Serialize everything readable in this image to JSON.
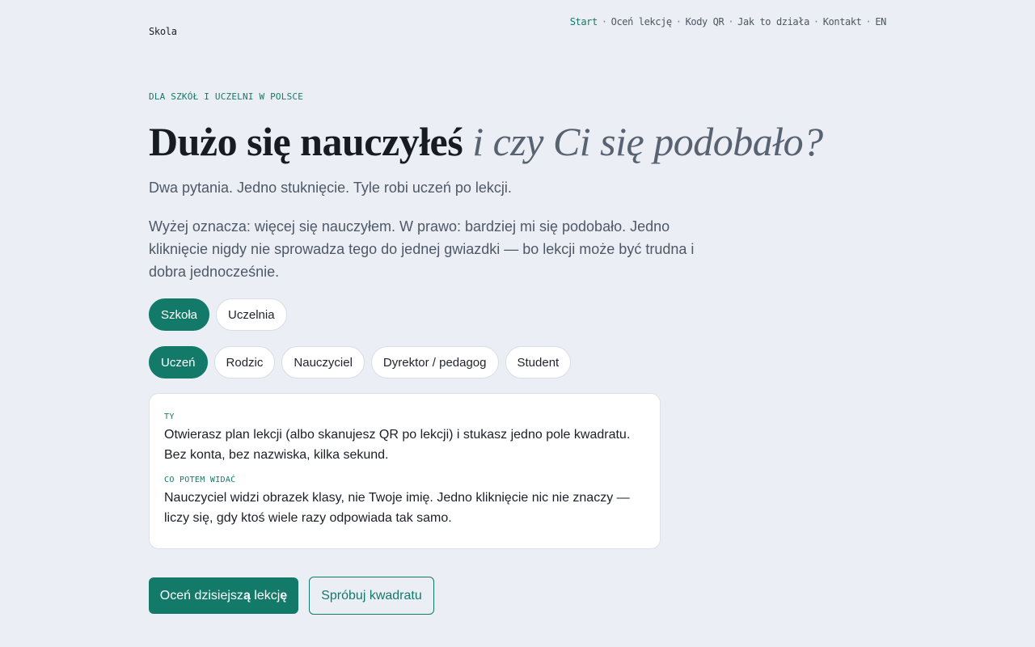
{
  "header": {
    "brand": "Skola",
    "nav": [
      {
        "label": "Start",
        "active": true
      },
      {
        "label": "Oceń lekcję",
        "active": false
      },
      {
        "label": "Kody QR",
        "active": false
      },
      {
        "label": "Jak to działa",
        "active": false
      },
      {
        "label": "Kontakt",
        "active": false
      },
      {
        "label": "EN",
        "active": false
      }
    ],
    "separator": "·"
  },
  "hero": {
    "eyebrow": "DLA SZKÓŁ I UCZELNI W POLSCE",
    "headline_strong": "Dużo się nauczyłeś",
    "headline_em": "i czy Ci się podobało?",
    "lead": "Dwa pytania. Jedno stuknięcie. Tyle robi uczeń po lekcji.",
    "description": "Wyżej oznacza: więcej się nauczyłem. W prawo: bardziej mi się podobało. Jedno kliknięcie nigdy nie sprowadza tego do jednej gwiazdki — bo lekcji może być trudna i dobra jednocześnie."
  },
  "institution_pills": [
    {
      "label": "Szkoła",
      "active": true
    },
    {
      "label": "Uczelnia",
      "active": false
    }
  ],
  "role_pills": [
    {
      "label": "Uczeń",
      "active": true
    },
    {
      "label": "Rodzic",
      "active": false
    },
    {
      "label": "Nauczyciel",
      "active": false
    },
    {
      "label": "Dyrektor / pedagog",
      "active": false
    },
    {
      "label": "Student",
      "active": false
    }
  ],
  "card": {
    "label_1": "TY",
    "text_1": "Otwierasz plan lekcji (albo skanujesz QR po lekcji) i stukasz jedno pole kwadratu. Bez konta, bez nazwiska, kilka sekund.",
    "label_2": "CO POTEM WIDAĆ",
    "text_2": "Nauczyciel widzi obrazek klasy, nie Twoje imię. Jedno kliknięcie nic nie znaczy — liczy się, gdy ktoś wiele razy odpowiada tak samo."
  },
  "cta": {
    "primary_prefix": "Oceń dzisiejsz",
    "primary_bold_1": "ą",
    "primary_middle": " lekcj",
    "primary_bold_2": "ę",
    "secondary": "Spróbuj kwadratu"
  },
  "colors": {
    "accent": "#137a69",
    "background": "#ebeef4",
    "card": "#ffffff",
    "text": "#1b1f27",
    "muted": "#4f5866"
  }
}
